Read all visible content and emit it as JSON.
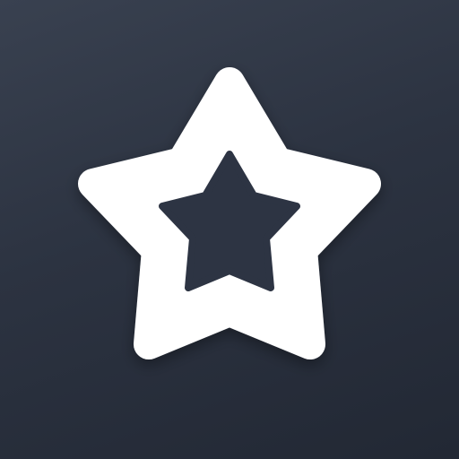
{
  "icon": {
    "name": "star-outline-icon",
    "glyph": "☆"
  },
  "colors": {
    "background_top": "#394150",
    "background_bottom": "#222834",
    "star_fill": "#ffffff",
    "star_cutout": "#2d3443"
  }
}
